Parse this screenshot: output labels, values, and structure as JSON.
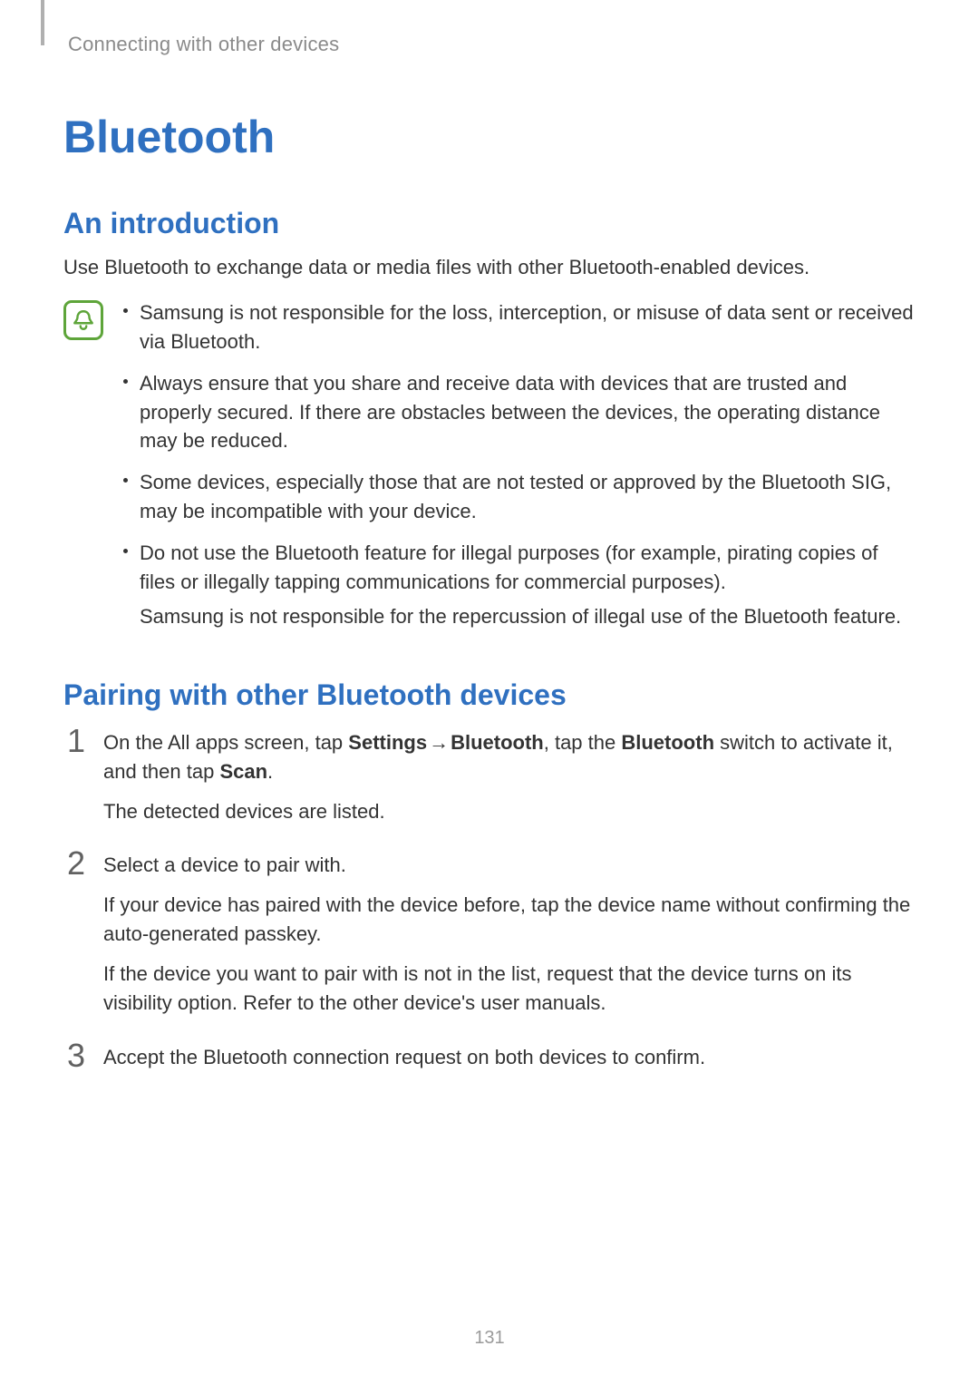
{
  "breadcrumb": "Connecting with other devices",
  "title": "Bluetooth",
  "sections": {
    "intro": {
      "heading": "An introduction",
      "text": "Use Bluetooth to exchange data or media files with other Bluetooth-enabled devices.",
      "notes": [
        "Samsung is not responsible for the loss, interception, or misuse of data sent or received via Bluetooth.",
        "Always ensure that you share and receive data with devices that are trusted and properly secured. If there are obstacles between the devices, the operating distance may be reduced.",
        "Some devices, especially those that are not tested or approved by the Bluetooth SIG, may be incompatible with your device.",
        "Do not use the Bluetooth feature for illegal purposes (for example, pirating copies of files or illegally tapping communications for commercial purposes)."
      ],
      "note4_extra": "Samsung is not responsible for the repercussion of illegal use of the Bluetooth feature."
    },
    "pairing": {
      "heading": "Pairing with other Bluetooth devices",
      "steps": {
        "s1": {
          "num": "1",
          "pre": "On the All apps screen, tap ",
          "b1": "Settings",
          "arrow": " → ",
          "b2": "Bluetooth",
          "mid": ", tap the ",
          "b3": "Bluetooth",
          "mid2": " switch to activate it, and then tap ",
          "b4": "Scan",
          "post": ".",
          "p2": "The detected devices are listed."
        },
        "s2": {
          "num": "2",
          "p1": "Select a device to pair with.",
          "p2": "If your device has paired with the device before, tap the device name without confirming the auto-generated passkey.",
          "p3": "If the device you want to pair with is not in the list, request that the device turns on its visibility option. Refer to the other device's user manuals."
        },
        "s3": {
          "num": "3",
          "p1": "Accept the Bluetooth connection request on both devices to confirm."
        }
      }
    }
  },
  "page_number": "131"
}
